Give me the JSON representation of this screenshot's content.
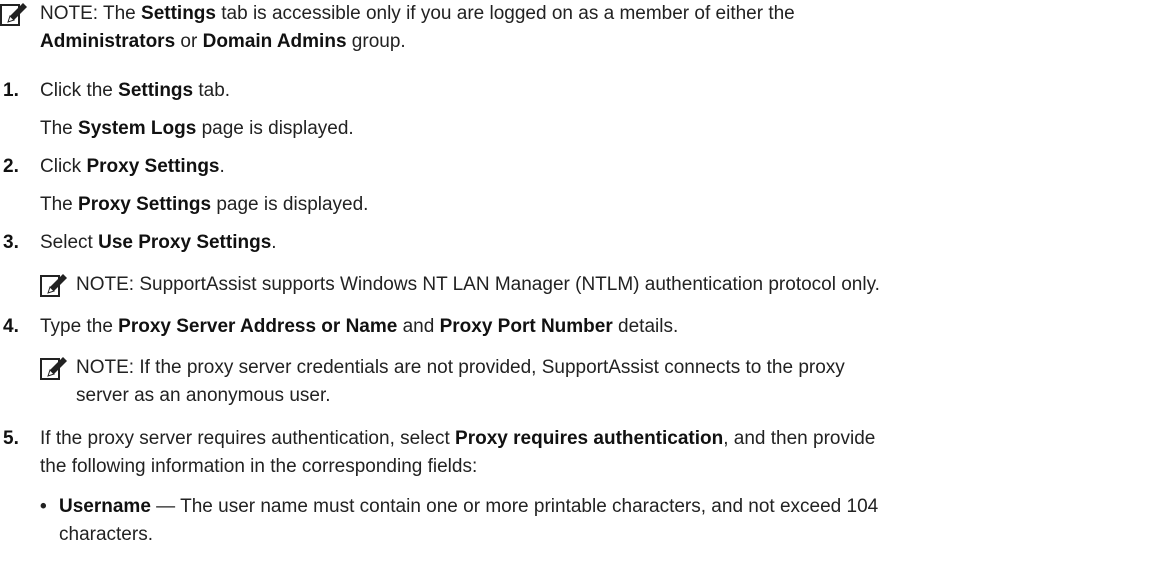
{
  "note_top": {
    "label": "NOTE:",
    "line1_a": " The ",
    "line1_b": "Settings",
    "line1_c": " tab is accessible only if you are logged on as a member of either the",
    "line2_a": "Administrators",
    "line2_b": " or ",
    "line2_c": "Domain Admins",
    "line2_d": " group."
  },
  "steps": [
    {
      "num": "1.",
      "a": "Click the ",
      "b": "Settings",
      "c": " tab.",
      "sub_a": "The ",
      "sub_b": "System Logs",
      "sub_c": " page is displayed."
    },
    {
      "num": "2.",
      "a": "Click ",
      "b": "Proxy Settings",
      "c": ".",
      "sub_a": "The ",
      "sub_b": "Proxy Settings",
      "sub_c": " page is displayed."
    },
    {
      "num": "3.",
      "a": "Select ",
      "b": "Use Proxy Settings",
      "c": ".",
      "note_label": "NOTE:",
      "note_text": " SupportAssist supports Windows NT LAN Manager (NTLM) authentication protocol only."
    },
    {
      "num": "4.",
      "a": "Type the ",
      "b": "Proxy Server Address or Name",
      "c": " and ",
      "d": "Proxy Port Number",
      "e": " details.",
      "note_label": "NOTE:",
      "note_line1": " If the proxy server credentials are not provided, SupportAssist connects to the proxy",
      "note_line2": "server as an anonymous user."
    },
    {
      "num": "5.",
      "a": "If the proxy server requires authentication, select ",
      "b": "Proxy requires authentication",
      "c": ", and then provide",
      "line2": "the following information in the corresponding fields:",
      "bullet": {
        "dot": "•",
        "label": "Username",
        "text1": " — The user name must contain one or more printable characters, and not exceed 104",
        "text2": "characters."
      }
    }
  ]
}
